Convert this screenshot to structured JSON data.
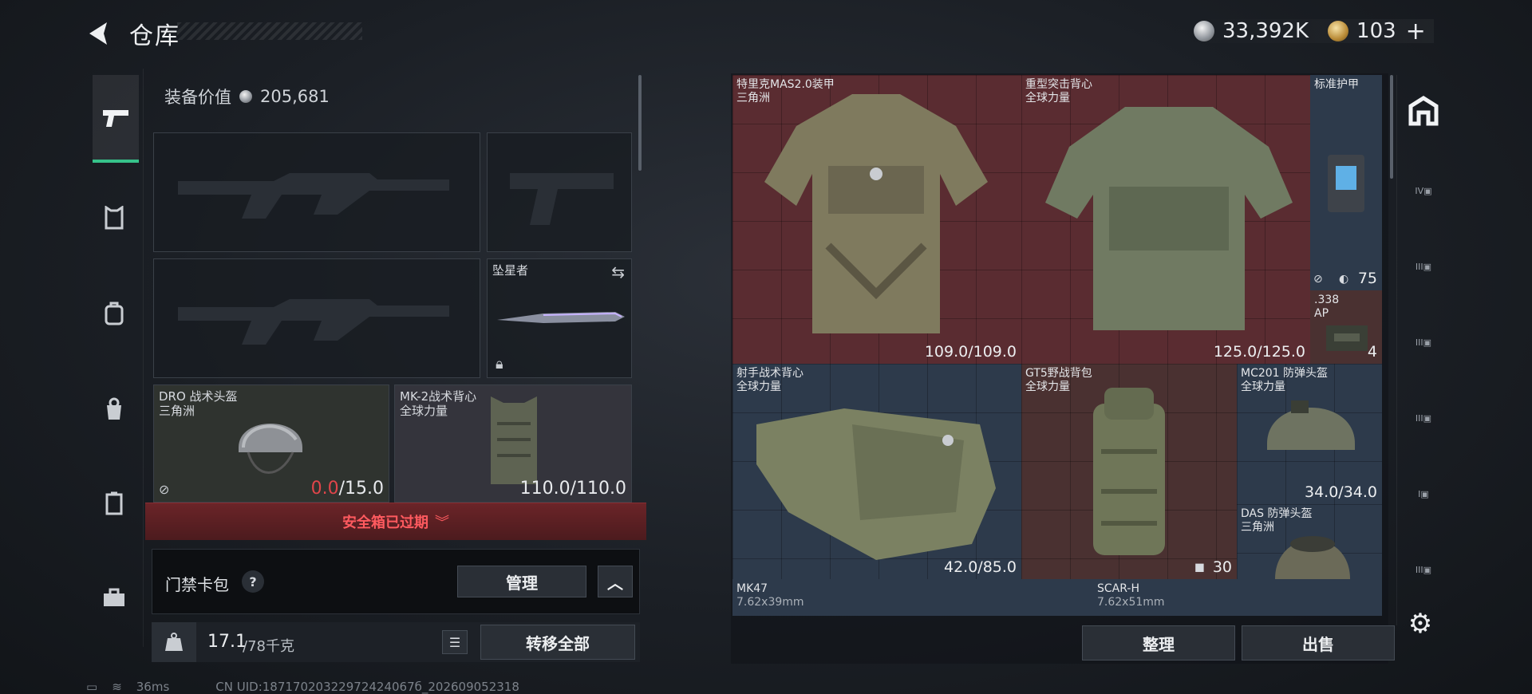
{
  "header": {
    "title": "仓库",
    "silver_amount": "33,392K",
    "gold_amount": "103",
    "gold_add": "+"
  },
  "loadout": {
    "equipment_value_label": "装备价值",
    "equipment_value": "205,681",
    "melee_name": "坠星者",
    "helmet": {
      "name": "DRO 战术头盔",
      "brand": "三角洲",
      "current": "0.0",
      "max": "/15.0"
    },
    "vest": {
      "name": "MK-2战术背心",
      "brand": "全球力量",
      "durability": "110.0/110.0"
    },
    "safe_box_status": "安全箱已过期",
    "keycard_label": "门禁卡包",
    "keycard_help": "?",
    "manage_label": "管理",
    "weight_value": "17.1",
    "weight_max": "/78千克",
    "transfer_all_label": "转移全部"
  },
  "stash": {
    "items": [
      {
        "name": "特里克MAS2.0装甲",
        "brand": "三角洲",
        "value": "109.0/109.0"
      },
      {
        "name": "重型突击背心",
        "brand": "全球力量",
        "value": "125.0/125.0"
      },
      {
        "name": "标准护甲",
        "brand": "",
        "value": "75"
      },
      {
        "name": ".338",
        "brand": "AP",
        "value": "4"
      },
      {
        "name": "射手战术背心",
        "brand": "全球力量",
        "value": "42.0/85.0"
      },
      {
        "name": "GT5野战背包",
        "brand": "全球力量",
        "value": "30"
      },
      {
        "name": "MC201 防弹头盔",
        "brand": "全球力量",
        "value": "34.0/34.0"
      },
      {
        "name": "DAS 防弹头盔",
        "brand": "三角洲",
        "value": ""
      },
      {
        "name": "MK47",
        "brand": "7.62x39mm",
        "value": ""
      },
      {
        "name": "SCAR-H",
        "brand": "7.62x51mm",
        "value": ""
      }
    ],
    "sort_label": "整理",
    "sell_label": "出售"
  },
  "side_filters": [
    "IV",
    "III",
    "III",
    "III",
    "I",
    "III"
  ],
  "status": {
    "ping": "36ms",
    "uid": "CN UID:18717020322972424067б_202609052318"
  }
}
